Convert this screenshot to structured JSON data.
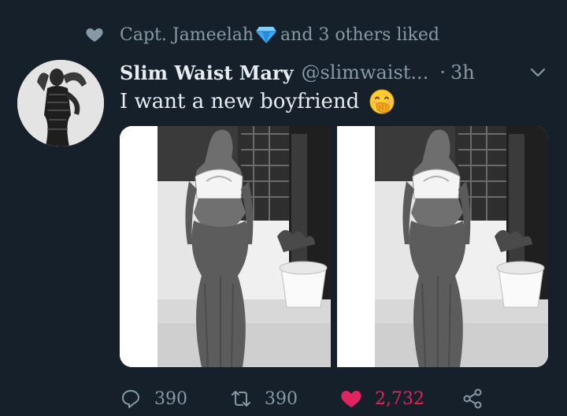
{
  "liked_banner": {
    "first_liker": "Capt. Jameelah",
    "suffix": "and 3 others liked"
  },
  "tweet": {
    "display_name": "Slim Waist Mary",
    "handle": "@slimwaist...",
    "separator": "·",
    "time": "3h",
    "text": "I want a new boyfriend",
    "emoji": "face-with-hand-over-mouth",
    "media_count": 2
  },
  "actions": {
    "replies": "390",
    "retweets": "390",
    "likes": "2,732",
    "liked": true
  },
  "colors": {
    "background": "#15202b",
    "primary_text": "#e6ecf0",
    "secondary_text": "#8899a6",
    "like_active": "#e0245e",
    "gem": "#3fa9f5"
  },
  "icons": {
    "liked_banner": "heart-icon",
    "gem": "gem-emoji-icon",
    "menu": "chevron-down-icon",
    "reply": "reply-icon",
    "retweet": "retweet-icon",
    "like": "heart-filled-icon",
    "share": "share-icon"
  }
}
